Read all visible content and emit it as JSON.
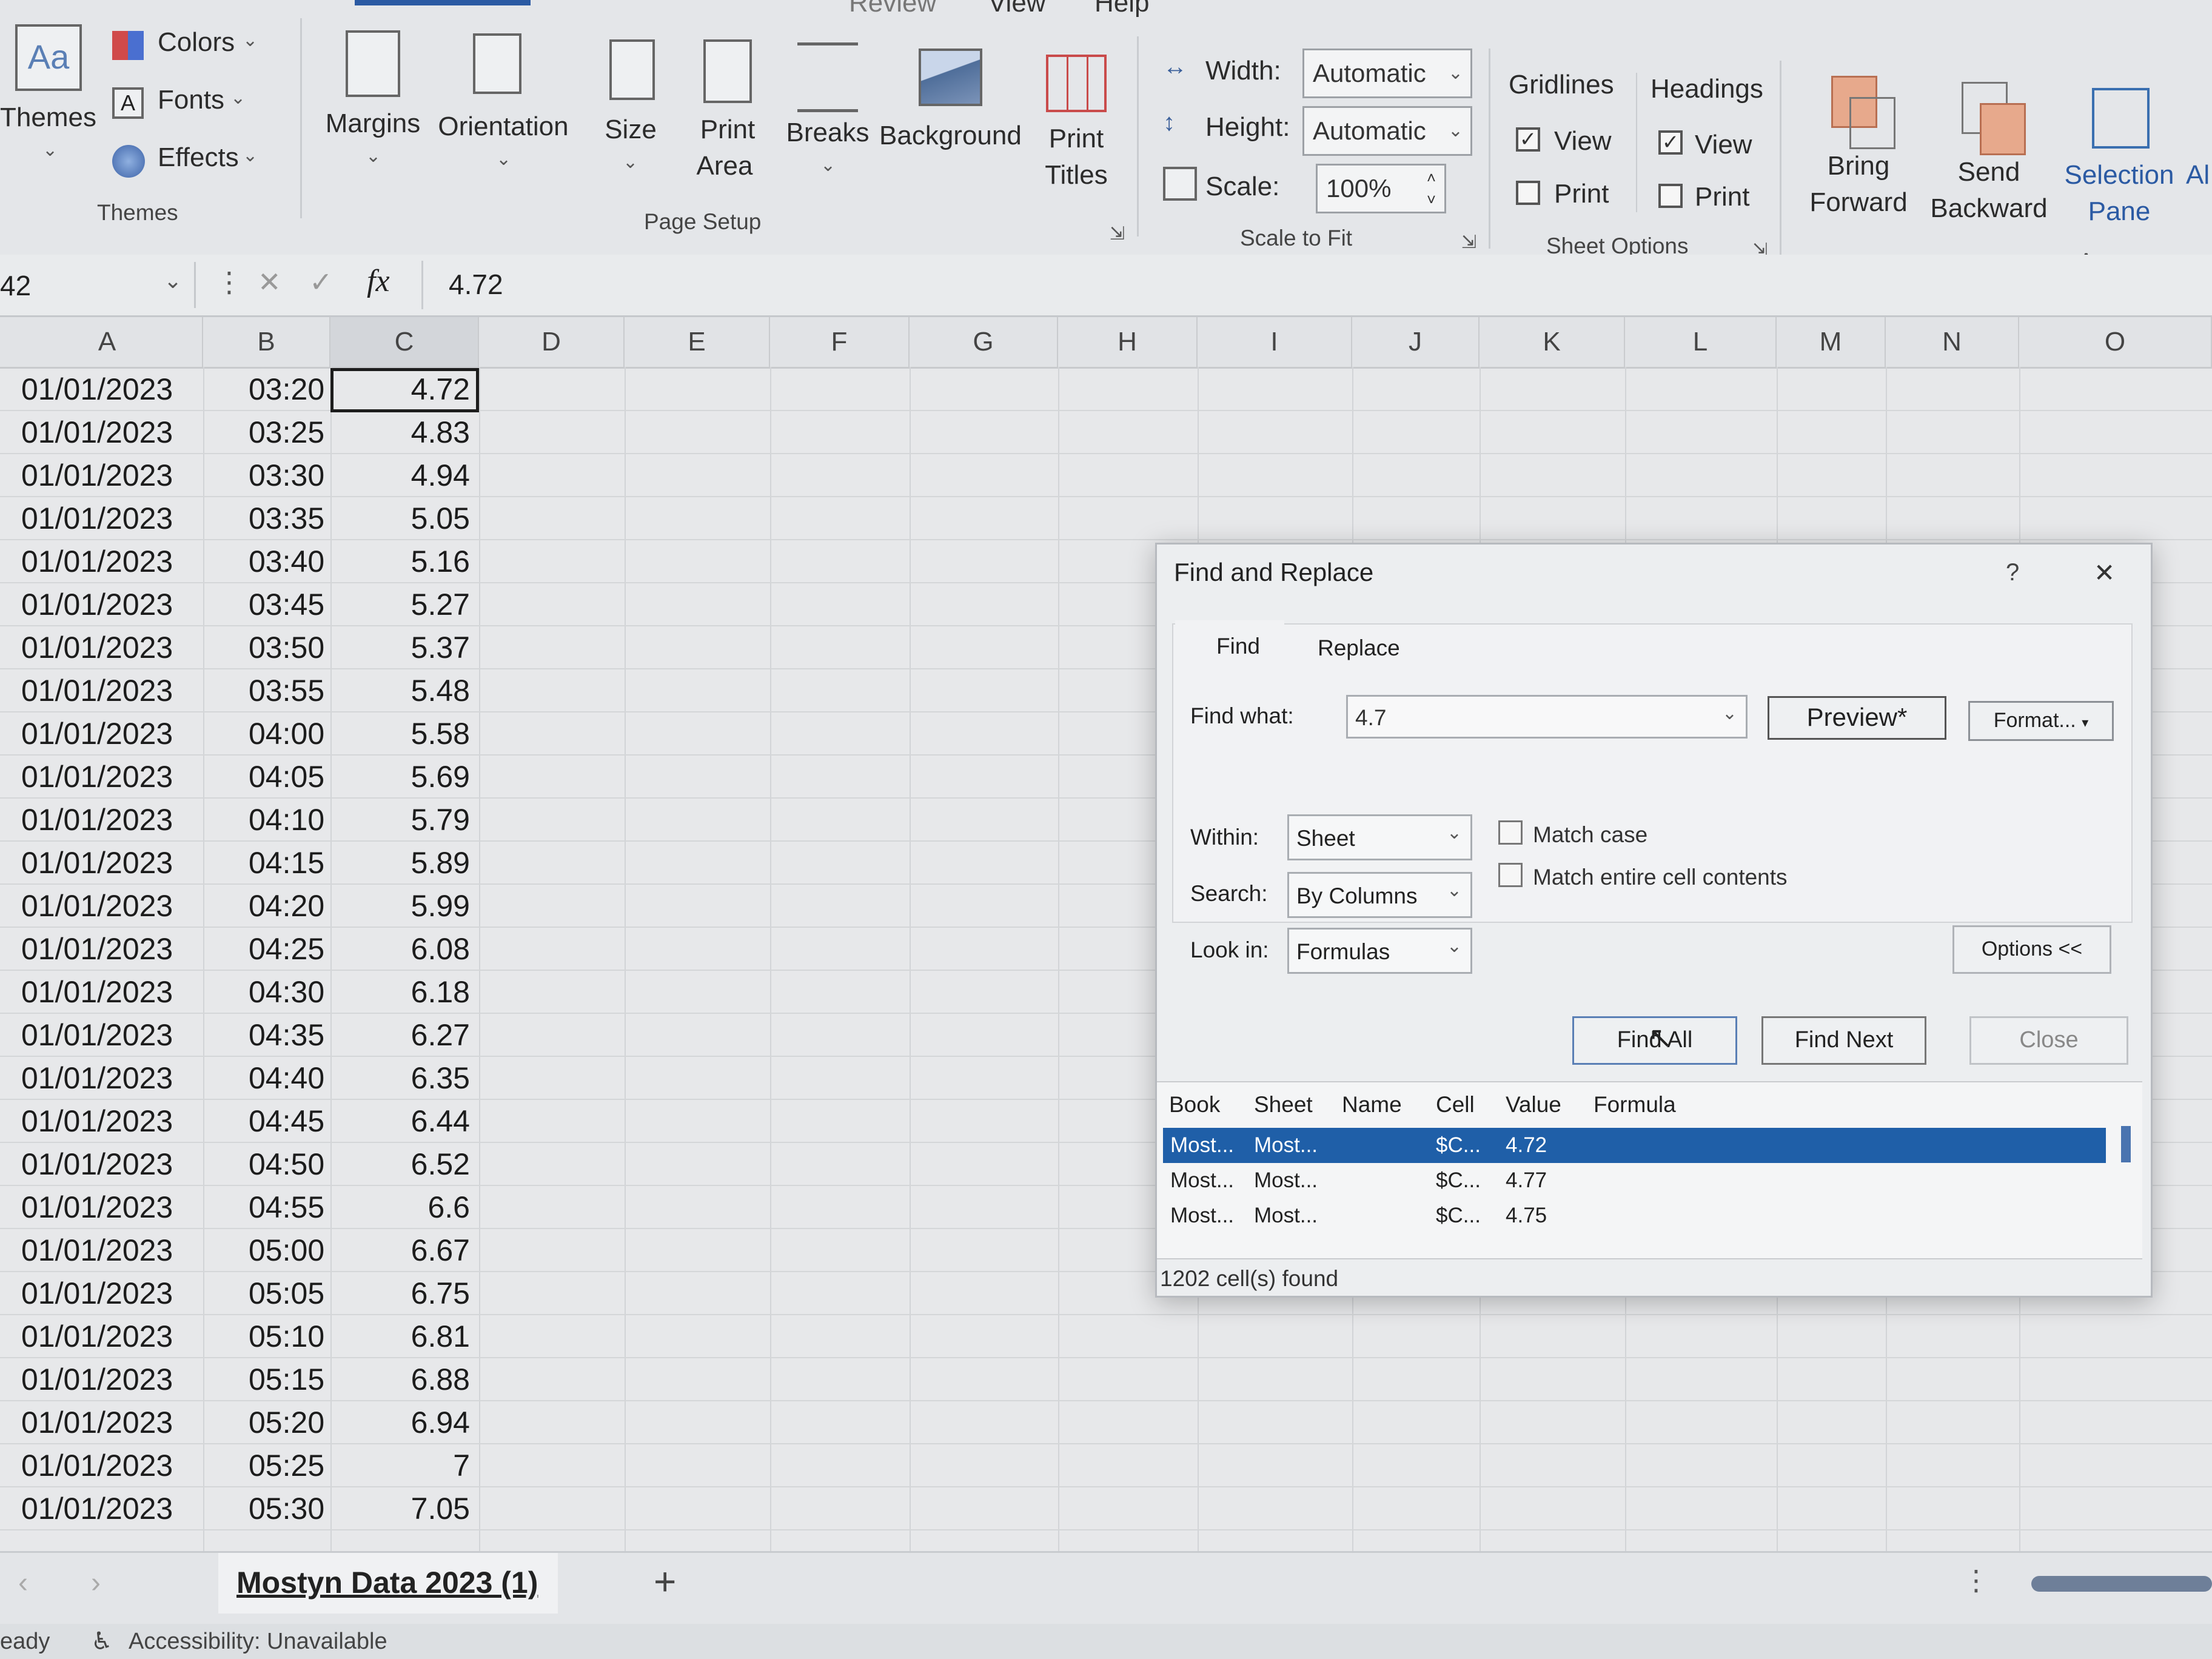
{
  "menu": {
    "review": "Review",
    "view": "View",
    "help": "Help"
  },
  "ribbon": {
    "themes": {
      "label": "Themes",
      "colors": "Colors",
      "fonts": "Fonts",
      "effects": "Effects",
      "group": "Themes"
    },
    "page_setup": {
      "margins": "Margins",
      "orientation": "Orientation",
      "size": "Size",
      "print_area_1": "Print",
      "print_area_2": "Area",
      "breaks": "Breaks",
      "background": "Background",
      "print_titles_1": "Print",
      "print_titles_2": "Titles",
      "group": "Page Setup"
    },
    "scale_to_fit": {
      "width_label": "Width:",
      "width_value": "Automatic",
      "height_label": "Height:",
      "height_value": "Automatic",
      "scale_label": "Scale:",
      "scale_value": "100%",
      "group": "Scale to Fit"
    },
    "sheet_options": {
      "gridlines": "Gridlines",
      "headings": "Headings",
      "view": "View",
      "print": "Print",
      "group": "Sheet Options"
    },
    "arrange": {
      "bring_1": "Bring",
      "bring_2": "Forward",
      "send_1": "Send",
      "send_2": "Backward",
      "sel_1": "Selection",
      "sel_2": "Pane",
      "align": "Al",
      "group": "Arrange"
    }
  },
  "formula_bar": {
    "name_box": "42",
    "fx": "fx",
    "value": "4.72"
  },
  "columns": [
    "A",
    "B",
    "C",
    "D",
    "E",
    "F",
    "G",
    "H",
    "I",
    "J",
    "K",
    "L",
    "M",
    "N",
    "O"
  ],
  "rows": [
    {
      "date": "01/01/2023",
      "time": "03:20",
      "value": "4.72"
    },
    {
      "date": "01/01/2023",
      "time": "03:25",
      "value": "4.83"
    },
    {
      "date": "01/01/2023",
      "time": "03:30",
      "value": "4.94"
    },
    {
      "date": "01/01/2023",
      "time": "03:35",
      "value": "5.05"
    },
    {
      "date": "01/01/2023",
      "time": "03:40",
      "value": "5.16"
    },
    {
      "date": "01/01/2023",
      "time": "03:45",
      "value": "5.27"
    },
    {
      "date": "01/01/2023",
      "time": "03:50",
      "value": "5.37"
    },
    {
      "date": "01/01/2023",
      "time": "03:55",
      "value": "5.48"
    },
    {
      "date": "01/01/2023",
      "time": "04:00",
      "value": "5.58"
    },
    {
      "date": "01/01/2023",
      "time": "04:05",
      "value": "5.69"
    },
    {
      "date": "01/01/2023",
      "time": "04:10",
      "value": "5.79"
    },
    {
      "date": "01/01/2023",
      "time": "04:15",
      "value": "5.89"
    },
    {
      "date": "01/01/2023",
      "time": "04:20",
      "value": "5.99"
    },
    {
      "date": "01/01/2023",
      "time": "04:25",
      "value": "6.08"
    },
    {
      "date": "01/01/2023",
      "time": "04:30",
      "value": "6.18"
    },
    {
      "date": "01/01/2023",
      "time": "04:35",
      "value": "6.27"
    },
    {
      "date": "01/01/2023",
      "time": "04:40",
      "value": "6.35"
    },
    {
      "date": "01/01/2023",
      "time": "04:45",
      "value": "6.44"
    },
    {
      "date": "01/01/2023",
      "time": "04:50",
      "value": "6.52"
    },
    {
      "date": "01/01/2023",
      "time": "04:55",
      "value": "6.6"
    },
    {
      "date": "01/01/2023",
      "time": "05:00",
      "value": "6.67"
    },
    {
      "date": "01/01/2023",
      "time": "05:05",
      "value": "6.75"
    },
    {
      "date": "01/01/2023",
      "time": "05:10",
      "value": "6.81"
    },
    {
      "date": "01/01/2023",
      "time": "05:15",
      "value": "6.88"
    },
    {
      "date": "01/01/2023",
      "time": "05:20",
      "value": "6.94"
    },
    {
      "date": "01/01/2023",
      "time": "05:25",
      "value": "7"
    },
    {
      "date": "01/01/2023",
      "time": "05:30",
      "value": "7.05"
    }
  ],
  "dialog": {
    "title": "Find and Replace",
    "help": "?",
    "close_x": "✕",
    "tab_find": "Find",
    "tab_replace": "Replace",
    "find_what_label": "Find what:",
    "find_what_value": "4.7",
    "preview": "Preview*",
    "format": "Format...",
    "within_label": "Within:",
    "within_value": "Sheet",
    "search_label": "Search:",
    "search_value": "By Columns",
    "lookin_label": "Look in:",
    "lookin_value": "Formulas",
    "match_case": "Match case",
    "match_entire": "Match entire cell contents",
    "options": "Options <<",
    "find_all": "Find All",
    "find_next": "Find Next",
    "close": "Close",
    "headers": [
      "Book",
      "Sheet",
      "Name",
      "Cell",
      "Value",
      "Formula"
    ],
    "results": [
      {
        "book": "Most...",
        "sheet": "Most...",
        "cell": "$C...",
        "value": "4.72"
      },
      {
        "book": "Most...",
        "sheet": "Most...",
        "cell": "$C...",
        "value": "4.77"
      },
      {
        "book": "Most...",
        "sheet": "Most...",
        "cell": "$C...",
        "value": "4.75"
      }
    ],
    "found": "1202 cell(s) found"
  },
  "sheet_tab": "Mostyn Data 2023 (1)",
  "add_sheet": "+",
  "status": {
    "ready": "eady",
    "accessibility": "Accessibility: Unavailable"
  }
}
